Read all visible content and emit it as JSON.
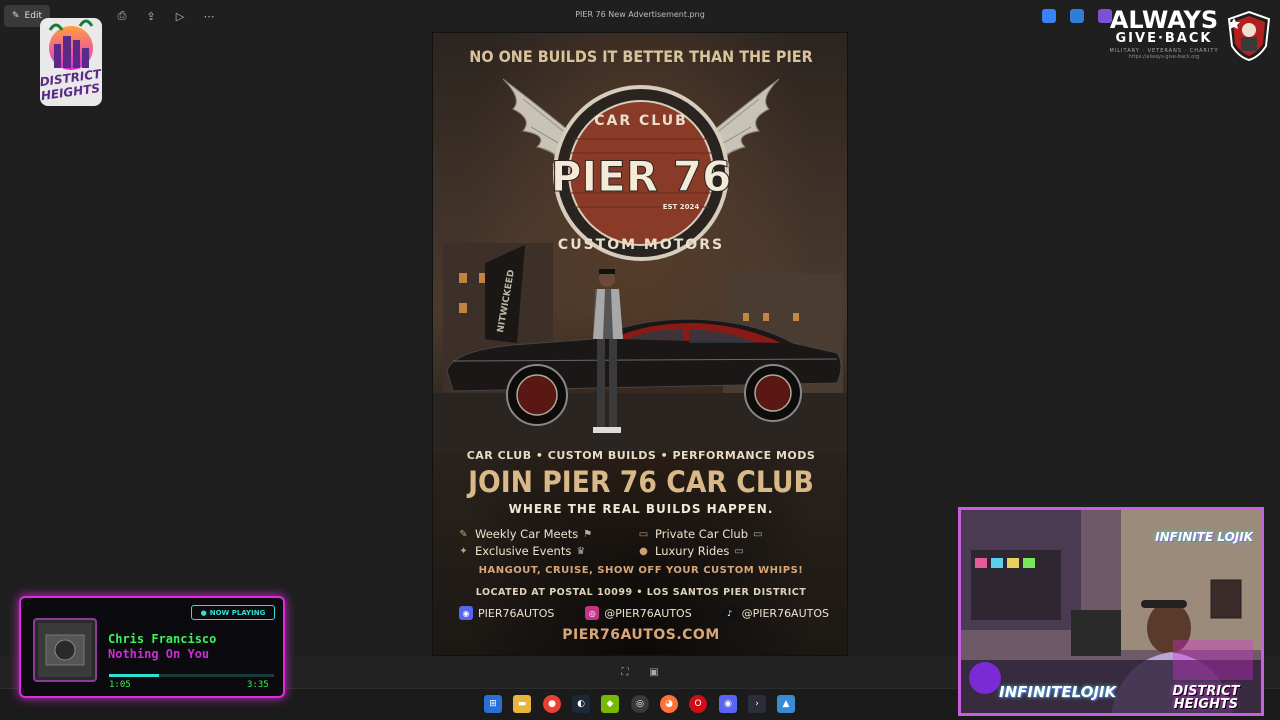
{
  "window": {
    "title": "PIER 76 New Advertisement.png",
    "edit_label": "Edit"
  },
  "overlay": {
    "left_logo_line1": "DISTRICT",
    "left_logo_line2": "HEIGHTS",
    "right_logo_line1": "ALWAYS",
    "right_logo_line2": "GIVE·BACK",
    "right_logo_line3": "MILITARY · VETERANS · CHARITY",
    "right_logo_line4": "https://always-give-back.org"
  },
  "poster": {
    "tagline": "NO ONE BUILDS IT BETTER THAN THE PIER",
    "emblem_top": "CAR CLUB",
    "emblem_name": "PIER 76",
    "emblem_est": "EST 2024",
    "emblem_bottom": "CUSTOM MOTORS",
    "banner_text": "NITWICKEED",
    "services": "CAR CLUB • CUSTOM BUILDS • PERFORMANCE MODS",
    "headline": "JOIN PIER 76 CAR CLUB",
    "subheadline": "WHERE THE REAL BUILDS HAPPEN.",
    "features": [
      {
        "label": "Weekly Car Meets",
        "icon": "wrench-icon",
        "icon2": "checkered-flag-icon"
      },
      {
        "label": "Private Car Club",
        "icon": "car-icon",
        "icon2": "car-icon"
      },
      {
        "label": "Exclusive Events",
        "icon": "party-icon",
        "icon2": "trophy-icon"
      },
      {
        "label": "Luxury Rides",
        "icon": "traffic-light-icon",
        "icon2": "car-icon"
      }
    ],
    "cta": "HANGOUT, CRUISE, SHOW OFF YOUR CUSTOM WHIPS!",
    "location": "LOCATED AT POSTAL 10099 • LOS SANTOS PIER DISTRICT",
    "socials": [
      {
        "platform": "discord",
        "handle": "PIER76AUTOS",
        "color": "#5865f2"
      },
      {
        "platform": "instagram",
        "handle": "@PIER76AUTOS",
        "color": "#c13584"
      },
      {
        "platform": "tiktok",
        "handle": "@PIER76AUTOS",
        "color": "#111111"
      }
    ],
    "website": "PIER76AUTOS.COM"
  },
  "now_playing": {
    "badge": "NOW PLAYING",
    "artist": "Chris Francisco",
    "song": "Nothing On You",
    "elapsed": "1:05",
    "total": "3:35",
    "progress": 0.3
  },
  "webcam": {
    "tag": "INFINITE LOJIK",
    "brand": "INFINITELOJIK",
    "dh_line1": "DISTRICT",
    "dh_line2": "HEIGHTS"
  },
  "taskbar": {
    "apps": [
      "start",
      "file-explorer",
      "chrome",
      "steam",
      "nvidia",
      "obs",
      "firefox",
      "opera",
      "discord",
      "terminal",
      "photos"
    ]
  }
}
